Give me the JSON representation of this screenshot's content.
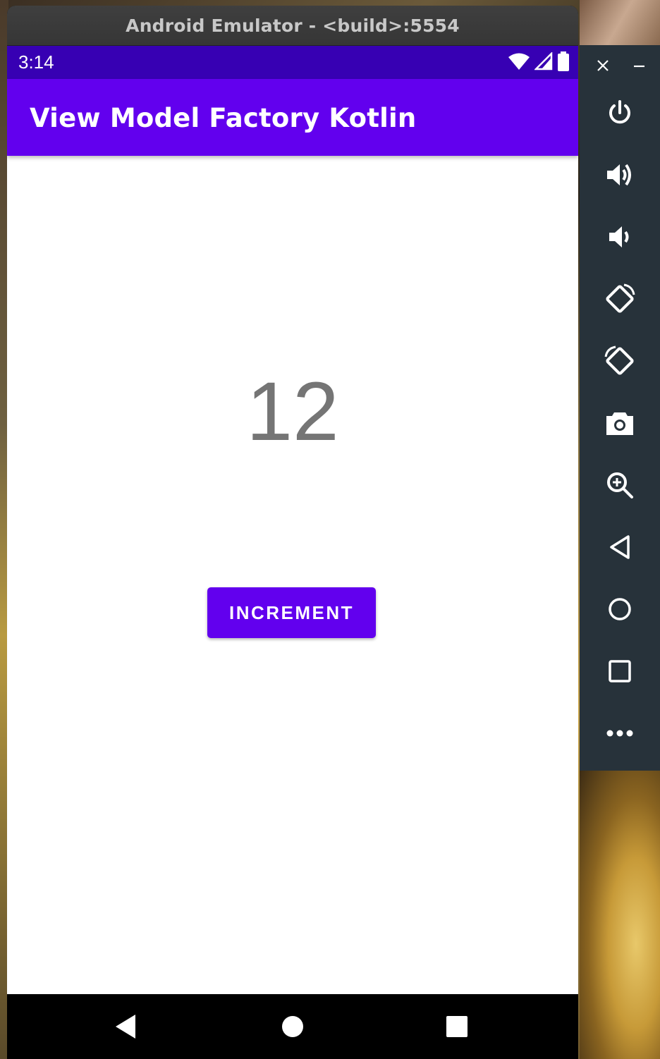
{
  "window": {
    "title": "Android Emulator - <build>:5554"
  },
  "status_bar": {
    "time": "3:14",
    "icons": [
      "wifi-icon",
      "signal-icon",
      "battery-icon"
    ],
    "color": "#3700b3"
  },
  "app_bar": {
    "title": "View Model Factory Kotlin",
    "color": "#6200ee"
  },
  "main": {
    "counter_value": "12",
    "increment_label": "INCREMENT"
  },
  "nav_bar": {
    "buttons": [
      "back-icon",
      "home-icon",
      "recents-icon"
    ]
  },
  "sidebar": {
    "window_controls": [
      "close-icon",
      "minimize-icon"
    ],
    "tools": [
      "power-icon",
      "volume-up-icon",
      "volume-down-icon",
      "rotate-left-icon",
      "rotate-right-icon",
      "camera-icon",
      "zoom-icon",
      "back-icon",
      "home-icon",
      "overview-icon",
      "more-icon"
    ],
    "color": "#27323a"
  }
}
